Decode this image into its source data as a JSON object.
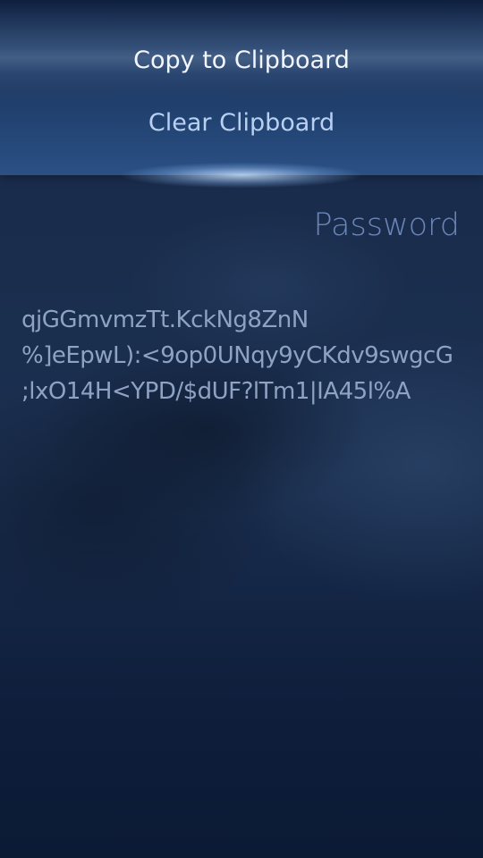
{
  "pulley_menu": {
    "items": [
      {
        "label": "Copy to Clipboard"
      },
      {
        "label": "Clear Clipboard"
      }
    ]
  },
  "page": {
    "header_title": "Password",
    "password_lines": [
      "qjGGmvmzTt.KckNg8ZnN",
      "%]eEpwL):<9op0UNqy9yCKdv9swgcG",
      ";lxO14H<YPD/$dUF?lTm1|IA45l%A"
    ]
  },
  "colors": {
    "menu_active_text": "#f2f6ff",
    "menu_text": "#b9d0f2",
    "header_text": "#6b86b6",
    "body_text": "#8ea2c4",
    "background": "#142540"
  }
}
